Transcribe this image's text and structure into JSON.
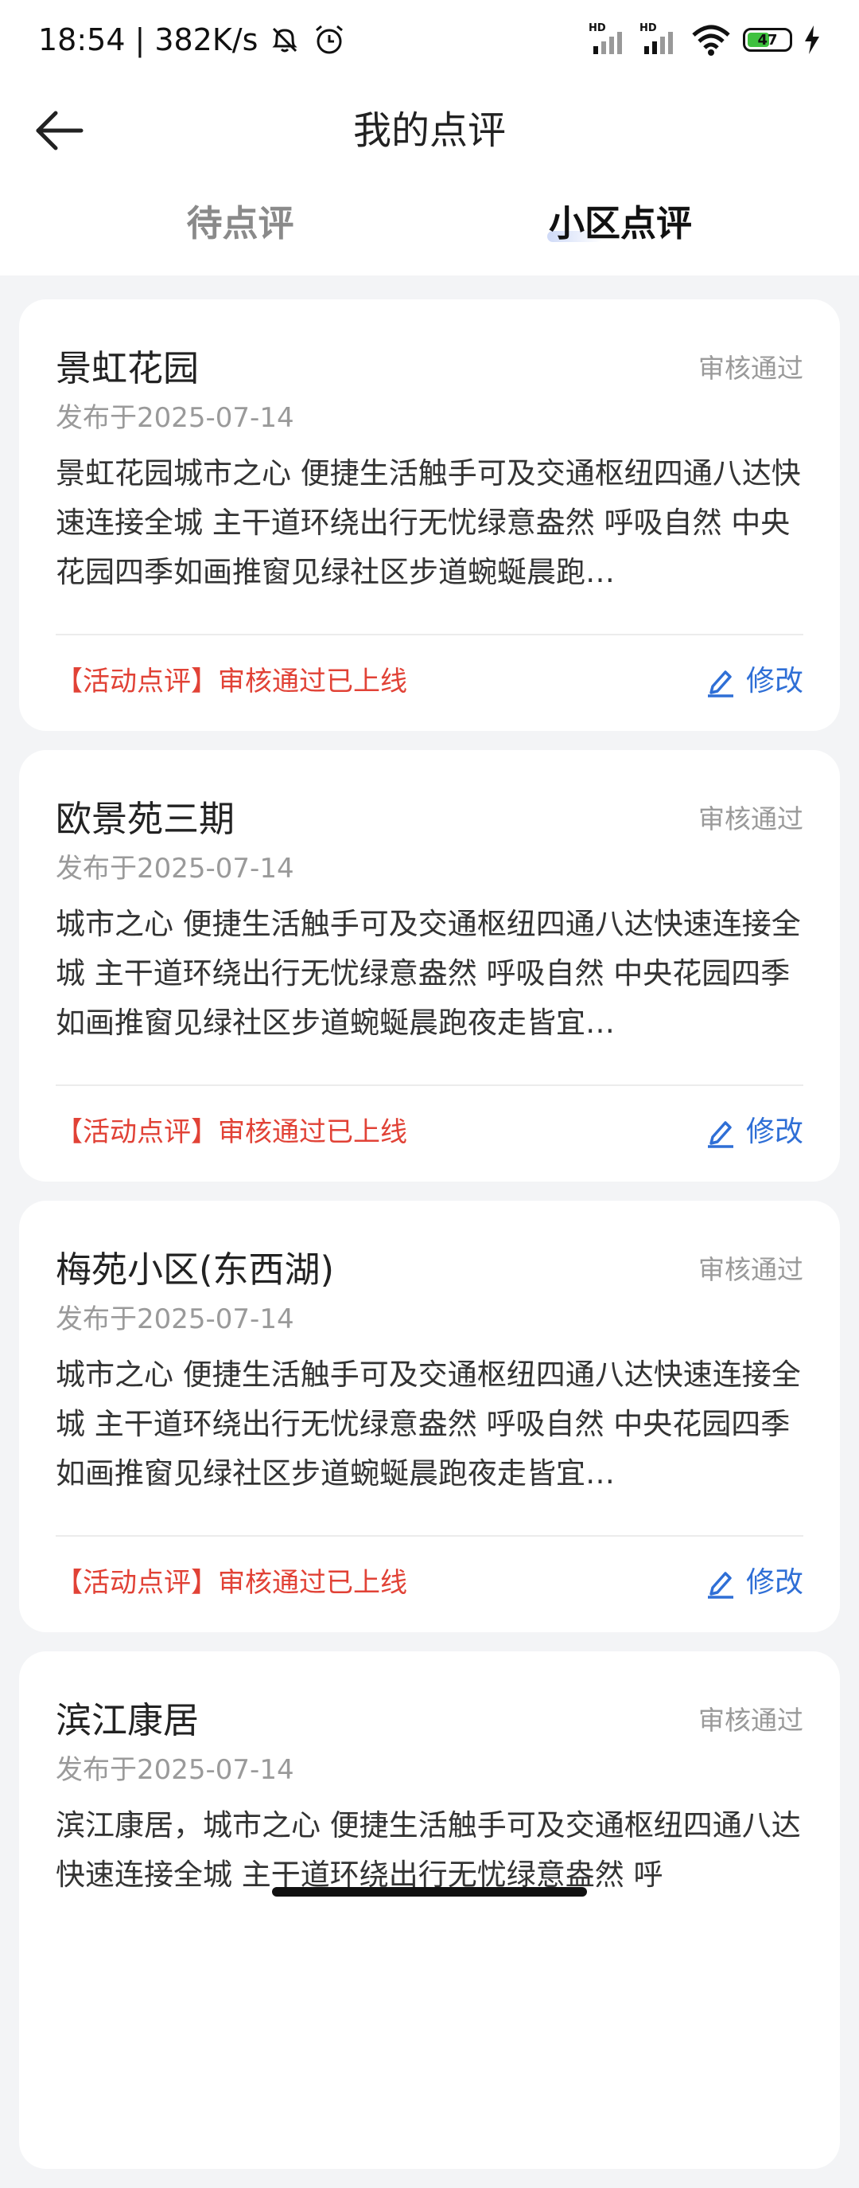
{
  "status_bar": {
    "time": "18:54",
    "speed": "382K/s",
    "signal1_label": "HD",
    "signal2_label": "HD",
    "battery": "47"
  },
  "header": {
    "title": "我的点评",
    "tabs": [
      {
        "label": "待点评",
        "active": false
      },
      {
        "label": "小区点评",
        "active": true
      }
    ]
  },
  "reviews": [
    {
      "name": "景虹花园",
      "status": "审核通过",
      "date": "发布于2025-07-14",
      "content": "景虹花园城市之心 便捷生活触手可及交通枢纽四通八达快速连接全城 主干道环绕出行无忧绿意盎然 呼吸自然 中央花园四季如画推窗见绿社区步道蜿蜒晨跑…",
      "tag": "【活动点评】审核通过已上线",
      "edit_label": "修改"
    },
    {
      "name": "欧景苑三期",
      "status": "审核通过",
      "date": "发布于2025-07-14",
      "content": "城市之心 便捷生活触手可及交通枢纽四通八达快速连接全城 主干道环绕出行无忧绿意盎然 呼吸自然 中央花园四季如画推窗见绿社区步道蜿蜒晨跑夜走皆宜…",
      "tag": "【活动点评】审核通过已上线",
      "edit_label": "修改"
    },
    {
      "name": "梅苑小区(东西湖)",
      "status": "审核通过",
      "date": "发布于2025-07-14",
      "content": "城市之心 便捷生活触手可及交通枢纽四通八达快速连接全城 主干道环绕出行无忧绿意盎然 呼吸自然 中央花园四季如画推窗见绿社区步道蜿蜒晨跑夜走皆宜…",
      "tag": "【活动点评】审核通过已上线",
      "edit_label": "修改"
    },
    {
      "name": "滨江康居",
      "status": "审核通过",
      "date": "发布于2025-07-14",
      "content": "滨江康居，城市之心 便捷生活触手可及交通枢纽四通八达快速连接全城 主干道环绕出行无忧绿意盎然 呼",
      "tag": "",
      "edit_label": ""
    }
  ]
}
